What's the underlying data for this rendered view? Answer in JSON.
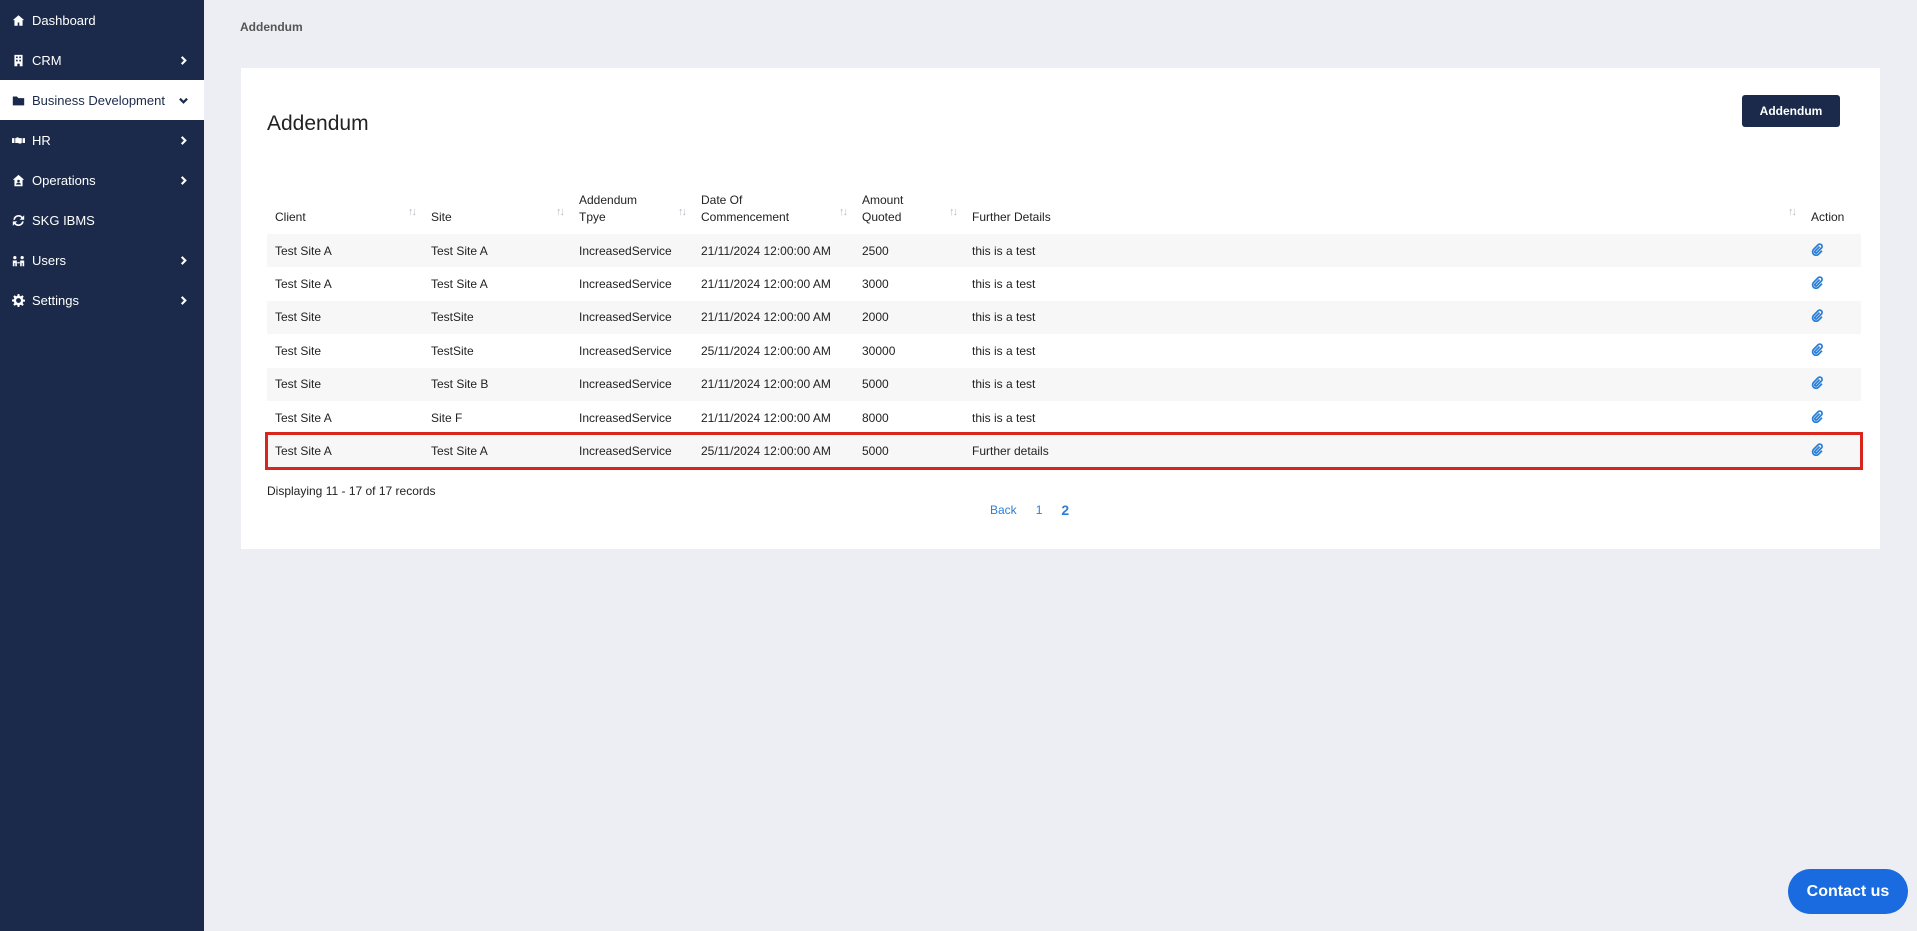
{
  "sidebar": {
    "items": [
      {
        "label": "Dashboard",
        "icon": "home-icon",
        "chevron": "none"
      },
      {
        "label": "CRM",
        "icon": "building-icon",
        "chevron": "right"
      },
      {
        "label": "Business Development",
        "icon": "folder-icon",
        "chevron": "down",
        "active": true
      },
      {
        "label": "HR",
        "icon": "handshake-icon",
        "chevron": "right"
      },
      {
        "label": "Operations",
        "icon": "house-user-icon",
        "chevron": "right"
      },
      {
        "label": "SKG IBMS",
        "icon": "sync-icon",
        "chevron": "none"
      },
      {
        "label": "Users",
        "icon": "users-icon",
        "chevron": "right"
      },
      {
        "label": "Settings",
        "icon": "gear-icon",
        "chevron": "right"
      }
    ]
  },
  "breadcrumb": "Addendum",
  "main": {
    "title": "Addendum",
    "add_button_label": "Addendum",
    "table": {
      "columns": [
        {
          "label": "Client",
          "sortable": true
        },
        {
          "label": "Site",
          "sortable": true
        },
        {
          "label": "Addendum Tpye",
          "sortable": true
        },
        {
          "label": "Date Of Commencement",
          "sortable": true
        },
        {
          "label": "Amount Quoted",
          "sortable": true
        },
        {
          "label": "Further Details",
          "sortable": true
        },
        {
          "label": "Action",
          "sortable": false
        }
      ],
      "rows": [
        [
          "Test Site A",
          "Test Site A",
          "IncreasedService",
          "21/11/2024 12:00:00 AM",
          "2500",
          "this is a test"
        ],
        [
          "Test Site A",
          "Test Site A",
          "IncreasedService",
          "21/11/2024 12:00:00 AM",
          "3000",
          "this is a test"
        ],
        [
          "Test Site",
          "TestSite",
          "IncreasedService",
          "21/11/2024 12:00:00 AM",
          "2000",
          "this is a test"
        ],
        [
          "Test Site",
          "TestSite",
          "IncreasedService",
          "25/11/2024 12:00:00 AM",
          "30000",
          "this is a test"
        ],
        [
          "Test Site",
          "Test Site B",
          "IncreasedService",
          "21/11/2024 12:00:00 AM",
          "5000",
          "this is a test"
        ],
        [
          "Test Site A",
          "Site F",
          "IncreasedService",
          "21/11/2024 12:00:00 AM",
          "8000",
          "this is a test"
        ],
        [
          "Test Site A",
          "Test Site A",
          "IncreasedService",
          "25/11/2024 12:00:00 AM",
          "5000",
          "Further details"
        ]
      ],
      "highlighted_row": 6,
      "action_icon": "paperclip-icon"
    },
    "records_info": "Displaying 11 - 17 of 17 records",
    "pagination": {
      "back": "Back",
      "pages": [
        "1",
        "2"
      ],
      "current": "2"
    }
  },
  "contact_button_label": "Contact us",
  "colors": {
    "sidebar": "#1b2a4a",
    "accent": "#2a7fd6",
    "highlight": "#d9261c",
    "contact": "#1a6be0"
  }
}
